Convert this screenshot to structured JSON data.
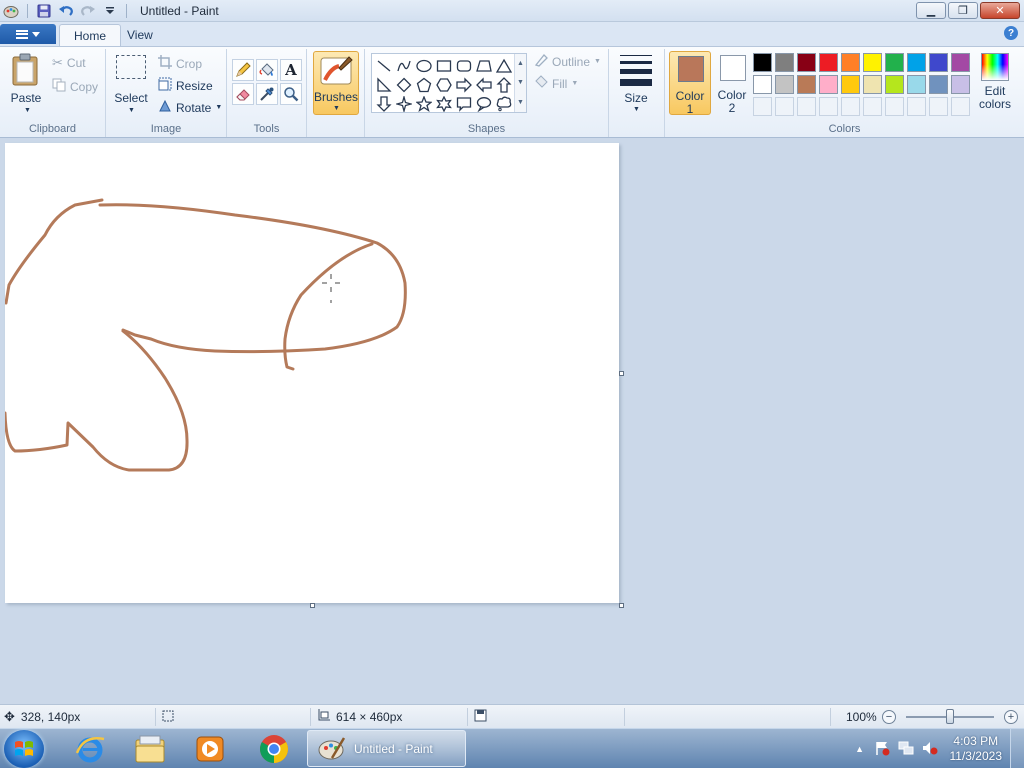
{
  "window": {
    "title": "Untitled - Paint"
  },
  "tabs": [
    {
      "label": "Home"
    },
    {
      "label": "View"
    }
  ],
  "ribbon": {
    "clipboard": {
      "label": "Clipboard",
      "paste": "Paste",
      "cut": "Cut",
      "copy": "Copy"
    },
    "image": {
      "label": "Image",
      "select": "Select",
      "crop": "Crop",
      "resize": "Resize",
      "rotate": "Rotate"
    },
    "tools": {
      "label": "Tools"
    },
    "brushes": {
      "label": "Brushes"
    },
    "shapes": {
      "label": "Shapes",
      "outline": "Outline",
      "fill": "Fill"
    },
    "size": {
      "label": "Size"
    },
    "colors": {
      "label": "Colors",
      "color1": "Color\n1",
      "color1_a": "Color",
      "color1_b": "1",
      "color2_a": "Color",
      "color2_b": "2",
      "edit_a": "Edit",
      "edit_b": "colors",
      "color1_value": "#b9775a",
      "color2_value": "#ffffff",
      "palette_row1": [
        "#000000",
        "#7f7f7f",
        "#880015",
        "#ed1c24",
        "#ff7f27",
        "#fff200",
        "#22b14c",
        "#00a2e8",
        "#3f48cc",
        "#a349a4"
      ],
      "palette_row2": [
        "#ffffff",
        "#c3c3c3",
        "#b97a57",
        "#ffaec9",
        "#ffc90e",
        "#efe4b0",
        "#b5e61d",
        "#99d9ea",
        "#7092be",
        "#c8bfe7"
      ]
    }
  },
  "canvas": {
    "stroke_color": "#b47a5a"
  },
  "status": {
    "cursor_pos": "328, 140px",
    "selection_size": "",
    "canvas_size": "614 × 460px",
    "zoom": "100%"
  },
  "taskbar": {
    "task_label": "Untitled - Paint",
    "time": "4:03 PM",
    "date": "11/3/2023"
  }
}
